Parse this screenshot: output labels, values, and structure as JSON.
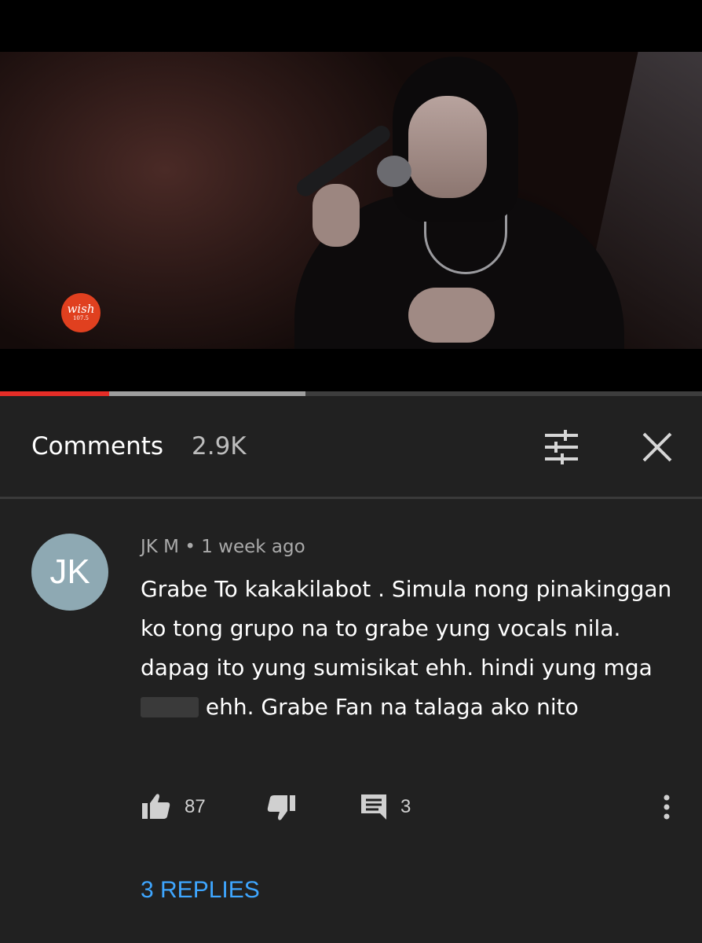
{
  "video": {
    "logo_text": "wish",
    "logo_subtext": "107.5",
    "progress_played": 0.155,
    "progress_buffered": 0.435
  },
  "comments_header": {
    "title": "Comments",
    "count": "2.9K",
    "filter_icon": "sort-sliders-icon",
    "close_icon": "close-icon"
  },
  "comment": {
    "avatar_initials": "JK",
    "avatar_color": "#8ea9b3",
    "author": "JK M",
    "time": "1 week ago",
    "text_before_censor": "Grabe To kakakilabot . Simula nong pinakinggan ko tong grupo na to grabe yung vocals nila. dapag ito yung sumisikat ehh. hindi yung mga",
    "text_after_censor": "ehh. Grabe Fan na talaga ako nito",
    "likes": "87",
    "reply_count": "3",
    "replies_label": "3 REPLIES"
  },
  "colors": {
    "background": "#212121",
    "progress_red": "#e52d27",
    "link_blue": "#3ea6ff"
  }
}
